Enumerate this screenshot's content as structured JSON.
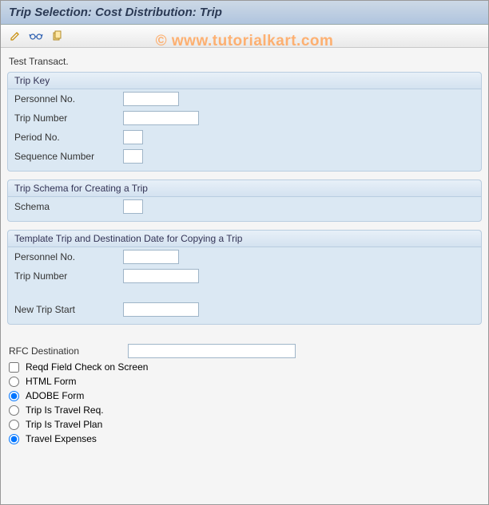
{
  "title": "Trip Selection: Cost Distribution: Trip",
  "watermark": "© www.tutorialkart.com",
  "toolbar": {
    "edit": "edit-icon",
    "glasses": "display-icon",
    "copy": "copy-icon"
  },
  "subheader": "Test Transact.",
  "groups": {
    "tripKey": {
      "title": "Trip Key",
      "personnelNoLabel": "Personnel No.",
      "personnelNo": "",
      "tripNumberLabel": "Trip Number",
      "tripNumber": "",
      "periodNoLabel": "Period No.",
      "periodNo": "",
      "sequenceNumberLabel": "Sequence Number",
      "sequenceNumber": ""
    },
    "tripSchema": {
      "title": "Trip Schema for Creating a Trip",
      "schemaLabel": "Schema",
      "schema": ""
    },
    "templateTrip": {
      "title": "Template Trip and Destination Date for Copying a Trip",
      "personnelNoLabel": "Personnel No.",
      "personnelNo": "",
      "tripNumberLabel": "Trip Number",
      "tripNumber": "",
      "newTripStartLabel": "New Trip Start",
      "newTripStart": ""
    }
  },
  "rfc": {
    "label": "RFC Destination",
    "value": ""
  },
  "options": {
    "reqdFieldCheck": "Reqd Field Check on Screen",
    "htmlForm": "HTML Form",
    "adobeForm": "ADOBE Form",
    "tripTravelReq": "Trip Is Travel Req.",
    "tripTravelPlan": "Trip Is Travel Plan",
    "travelExpenses": "Travel Expenses"
  }
}
